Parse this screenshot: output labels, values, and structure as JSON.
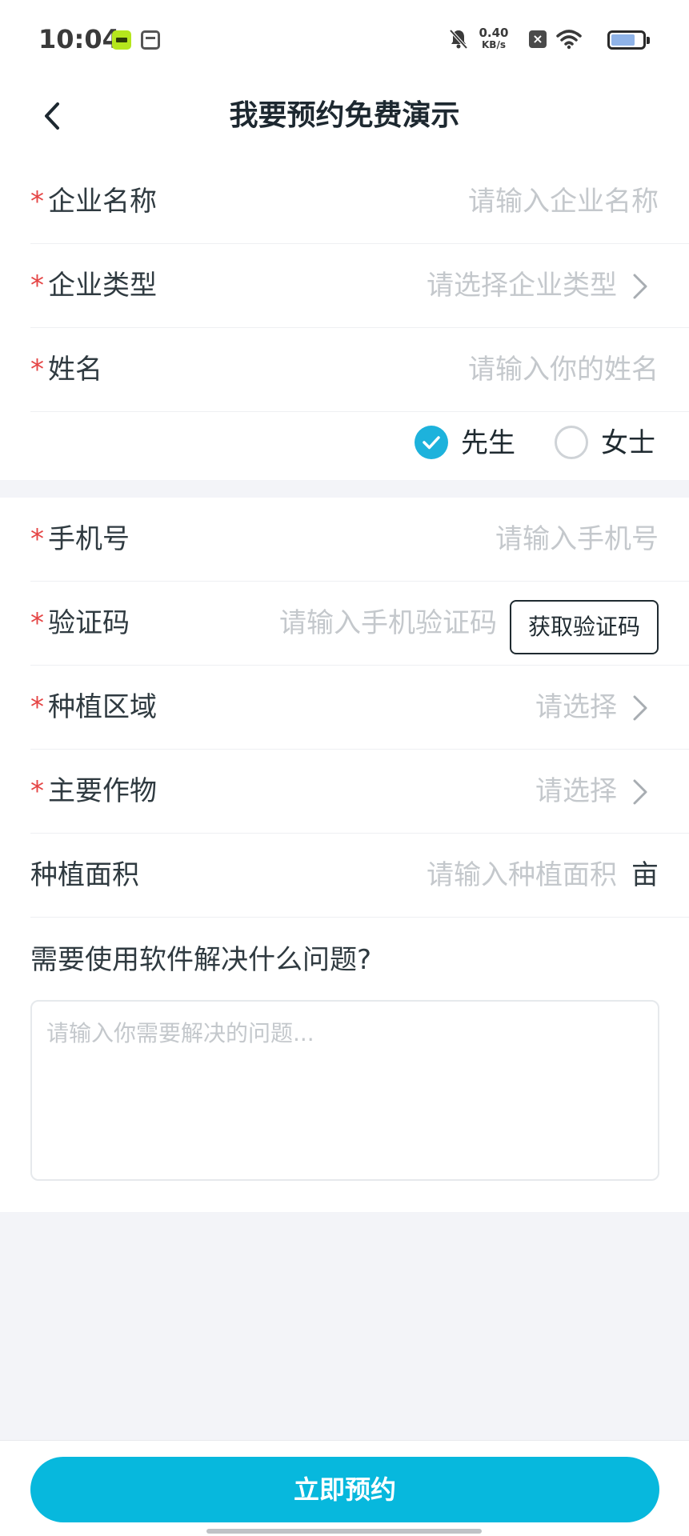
{
  "status_bar": {
    "time": "10:04",
    "net_speed": "0.40",
    "net_unit": "KB/s",
    "battery_level": 0.7
  },
  "nav": {
    "title": "我要预约免费演示"
  },
  "form": {
    "company_name": {
      "label": "企业名称",
      "placeholder": "请输入企业名称",
      "required": "*"
    },
    "company_type": {
      "label": "企业类型",
      "placeholder": "请选择企业类型",
      "required": "*"
    },
    "name": {
      "label": "姓名",
      "placeholder": "请输入你的姓名",
      "required": "*"
    },
    "gender": {
      "options": [
        {
          "label": "先生",
          "selected": true
        },
        {
          "label": "女士",
          "selected": false
        }
      ]
    },
    "phone": {
      "label": "手机号",
      "placeholder": "请输入手机号",
      "required": "*"
    },
    "code": {
      "label": "验证码",
      "placeholder": "请输入手机验证码",
      "button": "获取验证码",
      "required": "*"
    },
    "region": {
      "label": "种植区域",
      "placeholder": "请选择",
      "required": "*"
    },
    "crop": {
      "label": "主要作物",
      "placeholder": "请选择",
      "required": "*"
    },
    "area": {
      "label": "种植面积",
      "placeholder": "请输入种植面积",
      "unit": "亩"
    },
    "question": {
      "label": "需要使用软件解决什么问题?",
      "placeholder": "请输入你需要解决的问题..."
    }
  },
  "submit": {
    "label": "立即预约"
  },
  "colors": {
    "accent": "#07b8dd",
    "required": "#e54545",
    "placeholder": "#c4c8cc"
  }
}
